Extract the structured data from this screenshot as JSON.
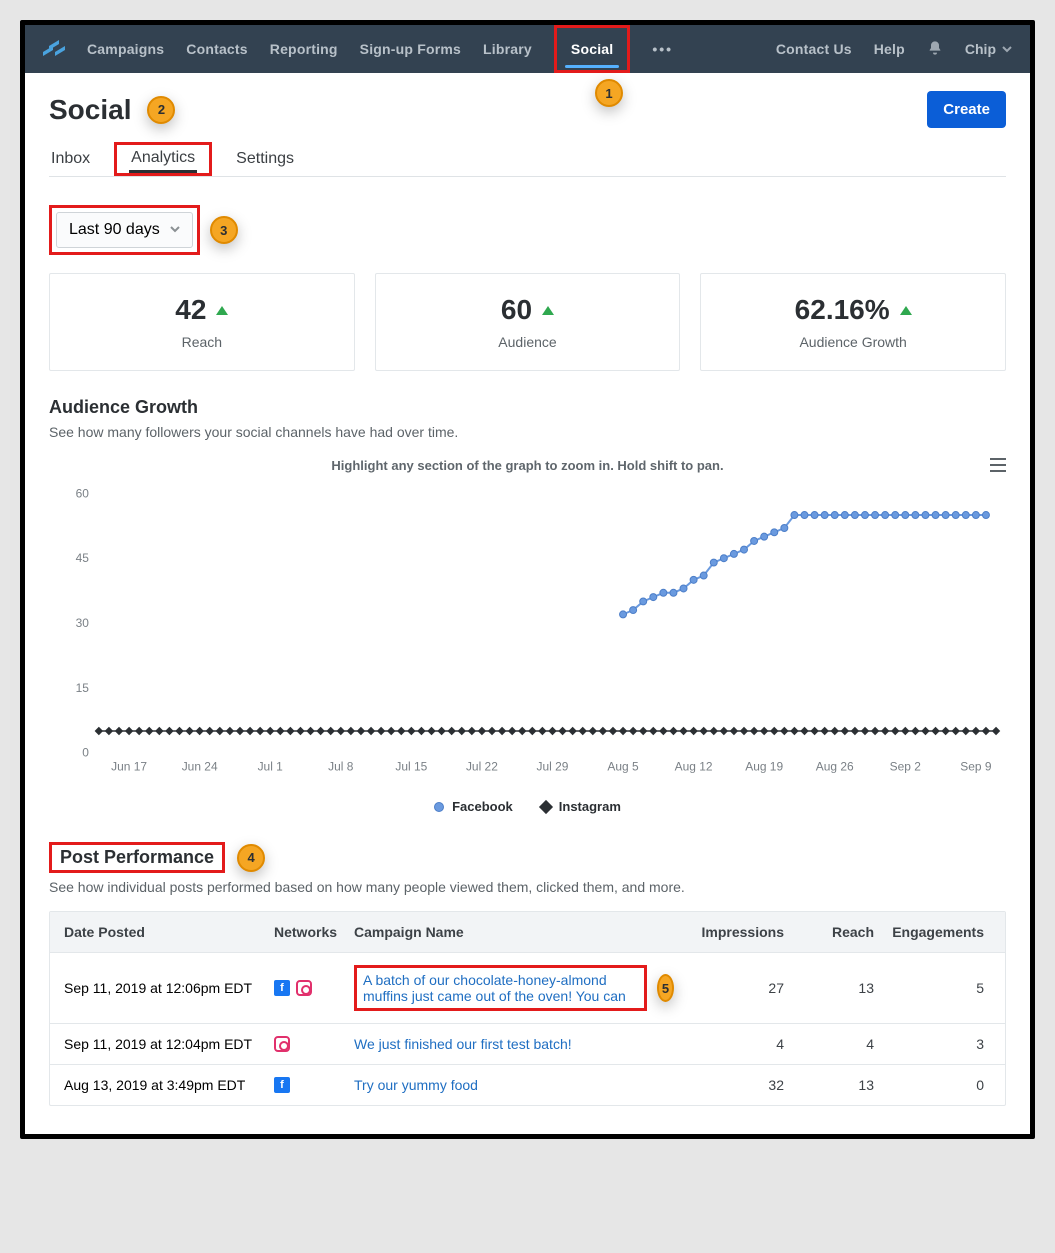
{
  "nav": {
    "items": [
      "Campaigns",
      "Contacts",
      "Reporting",
      "Sign-up Forms",
      "Library",
      "Social"
    ],
    "rightItems": [
      "Contact Us",
      "Help"
    ],
    "user": "Chip",
    "ellipsis": "•••"
  },
  "page": {
    "title": "Social",
    "createLabel": "Create",
    "subtabs": [
      "Inbox",
      "Analytics",
      "Settings"
    ],
    "dateRangeLabel": "Last 90 days"
  },
  "metrics": [
    {
      "value": "42",
      "label": "Reach",
      "trend": "up"
    },
    {
      "value": "60",
      "label": "Audience",
      "trend": "up"
    },
    {
      "value": "62.16%",
      "label": "Audience Growth",
      "trend": "up"
    }
  ],
  "audienceGrowth": {
    "title": "Audience Growth",
    "subtitle": "See how many followers your social channels have had over time.",
    "hint": "Highlight any section of the graph to zoom in. Hold shift to pan.",
    "legend": {
      "fb": "Facebook",
      "ig": "Instagram"
    }
  },
  "chart_data": {
    "type": "line",
    "xlabel": "",
    "ylabel": "",
    "ylim": [
      0,
      60
    ],
    "yticks": [
      0,
      15,
      30,
      45,
      60
    ],
    "xticks": [
      "Jun 17",
      "Jun 24",
      "Jul 1",
      "Jul 8",
      "Jul 15",
      "Jul 22",
      "Jul 29",
      "Aug 5",
      "Aug 12",
      "Aug 19",
      "Aug 26",
      "Sep 2",
      "Sep 9"
    ],
    "series": [
      {
        "name": "Facebook",
        "color": "#6a9adf",
        "x_start_index": 52,
        "values": [
          32,
          33,
          35,
          36,
          37,
          37,
          38,
          40,
          41,
          44,
          45,
          46,
          47,
          49,
          50,
          51,
          52,
          55,
          55,
          55,
          55,
          55,
          55,
          55,
          55,
          55,
          55,
          55,
          55,
          55,
          55,
          55,
          55,
          55,
          55,
          55,
          55
        ]
      },
      {
        "name": "Instagram",
        "color": "#2b2f33",
        "constant": 5,
        "x_span": [
          0,
          89
        ]
      }
    ],
    "days_total": 90
  },
  "postPerformance": {
    "title": "Post Performance",
    "subtitle": "See how individual posts performed based on how many people viewed them, clicked them, and more.",
    "columns": [
      "Date Posted",
      "Networks",
      "Campaign Name",
      "Impressions",
      "Reach",
      "Engagements"
    ],
    "rows": [
      {
        "date": "Sep 11, 2019 at 12:06pm EDT",
        "networks": [
          "fb",
          "ig"
        ],
        "name": "A batch of our chocolate-honey-almond muffins just came out of the oven! You can",
        "impressions": 27,
        "reach": 13,
        "engagements": 5,
        "highlighted": true
      },
      {
        "date": "Sep 11, 2019 at 12:04pm EDT",
        "networks": [
          "ig"
        ],
        "name": "We just finished our first test batch!",
        "impressions": 4,
        "reach": 4,
        "engagements": 3
      },
      {
        "date": "Aug 13, 2019 at 3:49pm EDT",
        "networks": [
          "fb"
        ],
        "name": "Try our yummy food",
        "impressions": 32,
        "reach": 13,
        "engagements": 0
      }
    ]
  },
  "annotations": {
    "1": "1",
    "2": "2",
    "3": "3",
    "4": "4",
    "5": "5"
  }
}
